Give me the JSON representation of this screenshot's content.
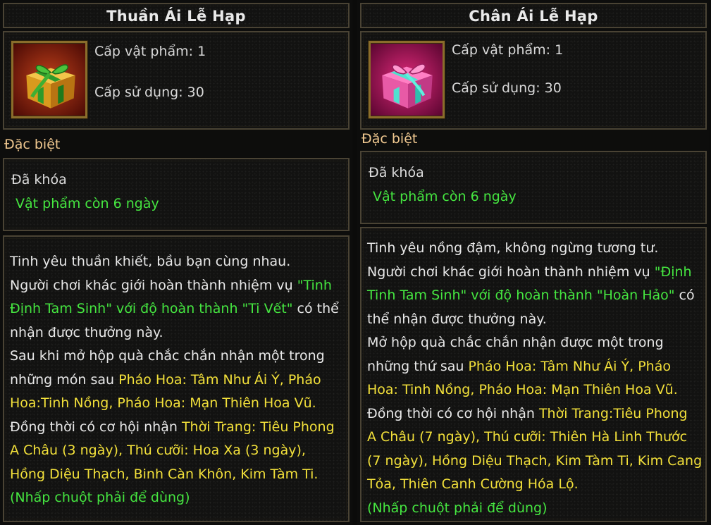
{
  "panels": [
    {
      "title": "Thuần Ái Lễ Hạp",
      "icon": "gift-box-green-gold",
      "stat1": "Cấp vật phẩm: 1",
      "stat2": "Cấp sử dụng: 30",
      "special": "Đặc biệt",
      "locked": "Đã khóa",
      "expiry": "Vật phẩm còn 6 ngày",
      "desc": [
        [
          {
            "t": "Tinh yêu thuần khiết, bầu bạn cùng nhau.",
            "c": "w"
          }
        ],
        [
          {
            "t": "Người chơi khác giới hoàn thành nhiệm vụ ",
            "c": "w"
          },
          {
            "t": "\"Tinh",
            "c": "g"
          }
        ],
        [
          {
            "t": " Định Tam Sinh\" với độ hoàn thành \"Ti Vết\"",
            "c": "g"
          },
          {
            "t": " có thể",
            "c": "w"
          }
        ],
        [
          {
            "t": " nhận được thưởng này.",
            "c": "w"
          }
        ],
        [
          {
            "t": "Sau khi mở hộp quà chắc chắn nhận một trong",
            "c": "w"
          }
        ],
        [
          {
            "t": " những món sau ",
            "c": "w"
          },
          {
            "t": "Pháo Hoa: Tâm Như Ái Ý, Pháo",
            "c": "y"
          }
        ],
        [
          {
            "t": " Hoa:Tinh Nồng, Pháo Hoa: Mạn Thiên Hoa Vũ.",
            "c": "y"
          }
        ],
        [
          {
            "t": " Đồng thời có cơ hội nhận ",
            "c": "w"
          },
          {
            "t": "Thời Trang: Tiêu Phong",
            "c": "y"
          }
        ],
        [
          {
            "t": " A Châu (3 ngày), Thú cưỡi: Hoa Xa (3 ngày),",
            "c": "y"
          }
        ],
        [
          {
            "t": " Hồng Diệu Thạch, Binh Càn Khôn, Kim Tàm Ti.",
            "c": "y"
          }
        ],
        [
          {
            "t": "(Nhấp chuột phải để dùng)",
            "c": "g"
          }
        ]
      ]
    },
    {
      "title": "Chân Ái Lễ Hạp",
      "icon": "gift-box-pink-teal",
      "stat1": "Cấp vật phẩm: 1",
      "stat2": "Cấp sử dụng: 30",
      "special": "Đặc biệt",
      "locked": "Đã khóa",
      "expiry": "Vật phẩm còn 6 ngày",
      "desc": [
        [
          {
            "t": "Tinh yêu nồng đậm, không ngừng tương tư.",
            "c": "w"
          }
        ],
        [
          {
            "t": "Người chơi khác giới hoàn thành nhiệm vụ ",
            "c": "w"
          },
          {
            "t": "\"Định",
            "c": "g"
          }
        ],
        [
          {
            "t": " Tinh Tam Sinh\" với độ hoàn thành \"Hoàn Hảo\"",
            "c": "g"
          },
          {
            "t": " có",
            "c": "w"
          }
        ],
        [
          {
            "t": " thể nhận được thưởng này.",
            "c": "w"
          }
        ],
        [
          {
            "t": "Mở hộp quà chắc chắn nhận được một trong",
            "c": "w"
          }
        ],
        [
          {
            "t": " những thứ sau ",
            "c": "w"
          },
          {
            "t": "Pháo Hoa: Tâm Như Ái Ý, Pháo",
            "c": "y"
          }
        ],
        [
          {
            "t": " Hoa: Tinh Nồng, Pháo Hoa: Mạn Thiên Hoa Vũ.",
            "c": "y"
          }
        ],
        [
          {
            "t": " Đồng thời có cơ hội nhận ",
            "c": "w"
          },
          {
            "t": "Thời Trang:Tiêu Phong",
            "c": "y"
          }
        ],
        [
          {
            "t": " A Châu (7 ngày), Thú cưỡi: Thiên Hà Linh Thước",
            "c": "y"
          }
        ],
        [
          {
            "t": " (7 ngày), Hồng Diệu Thạch, Kim Tàm Ti, Kim Cang",
            "c": "y"
          }
        ],
        [
          {
            "t": " Tỏa, Thiên Canh Cường Hóa Lộ.",
            "c": "y"
          }
        ],
        [
          {
            "t": "(Nhấp chuột phải để dùng)",
            "c": "g"
          }
        ]
      ]
    }
  ],
  "colors": {
    "green": "#45e640",
    "yellow": "#f2e03a",
    "label": "#f0c890"
  }
}
